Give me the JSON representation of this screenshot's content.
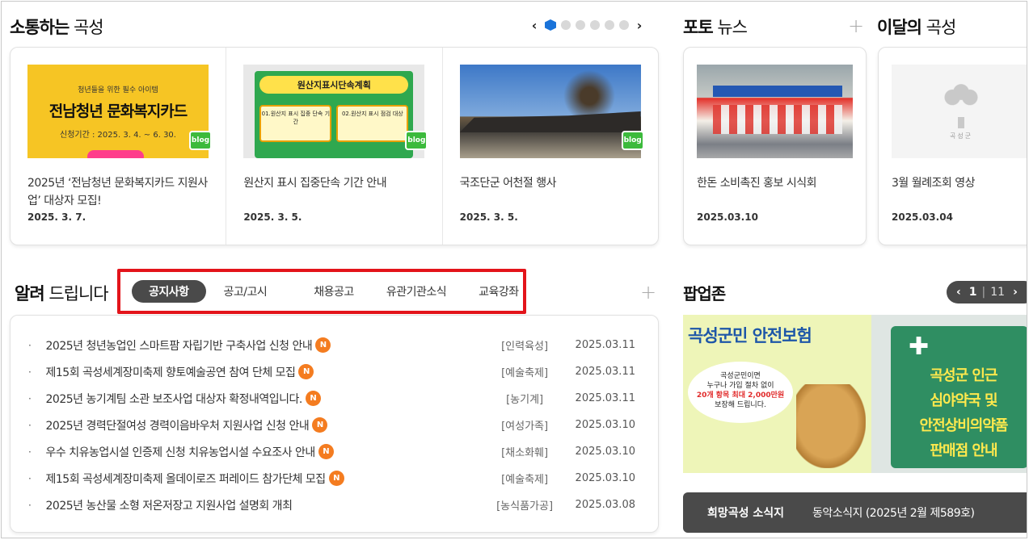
{
  "sections": {
    "blog": {
      "title_bold": "소통하는",
      "title_light": "곡성"
    },
    "photo": {
      "title_bold": "포토",
      "title_light": "뉴스"
    },
    "month": {
      "title_bold": "이달의",
      "title_light": "곡성"
    },
    "notice": {
      "title_bold": "알려",
      "title_light": "드립니다"
    },
    "popup": {
      "title_bold": "팝업존"
    }
  },
  "slider": {
    "prev": "‹",
    "next": "›",
    "dot_count": 6,
    "active_index": 0
  },
  "plus_symbol": "+",
  "blog_badge": "blog",
  "blog_cards": [
    {
      "title": "2025년 ‘전남청년 문화복지카드 지원사업’ 대상자 모집!",
      "date": "2025. 3. 7.",
      "thumb": {
        "sub": "청년들을 위한 필수 아이템",
        "main": "전남청년 문화복지카드",
        "period": "신청기간 : 2025. 3. 4. ~ 6. 30."
      }
    },
    {
      "title": "원산지 표시 집중단속 기간 안내",
      "date": "2025. 3. 5.",
      "thumb": {
        "head": "원산지표시단속계획",
        "box1": "01.원산지 표시 집중 단속 기간",
        "box2": "02.원산지 표시 점검 대상"
      }
    },
    {
      "title": "국조단군 어천절 행사",
      "date": "2025. 3. 5."
    }
  ],
  "photo_news": [
    {
      "title": "한돈 소비촉진 홍보 시식회",
      "date": "2025.03.10"
    }
  ],
  "month_items": [
    {
      "title": "3월 월례조회 영상",
      "date": "2025.03.04",
      "logo_text": "곡성군"
    }
  ],
  "notice_tabs": [
    {
      "label": "공지사항",
      "active": true
    },
    {
      "label": "공고/고시",
      "active": false
    },
    {
      "label": "채용공고",
      "active": false
    },
    {
      "label": "유관기관소식",
      "active": false
    },
    {
      "label": "교육강좌",
      "active": false
    }
  ],
  "new_badge": "N",
  "notices": [
    {
      "title": "2025년 청년농업인 스마트팜 자립기반 구축사업 신청 안내",
      "is_new": true,
      "category": "[인력육성]",
      "date": "2025.03.11"
    },
    {
      "title": "제15회 곡성세계장미축제 향토예술공연 참여 단체 모집",
      "is_new": true,
      "category": "[예술축제]",
      "date": "2025.03.11"
    },
    {
      "title": "2025년 농기계팀 소관 보조사업 대상자 확정내역입니다.",
      "is_new": true,
      "category": "[농기계]",
      "date": "2025.03.11"
    },
    {
      "title": "2025년 경력단절여성 경력이음바우처 지원사업 신청 안내",
      "is_new": true,
      "category": "[여성가족]",
      "date": "2025.03.10"
    },
    {
      "title": "우수 치유농업시설 인증제 신청 치유농업시설 수요조사 안내",
      "is_new": true,
      "category": "[채소화훼]",
      "date": "2025.03.10"
    },
    {
      "title": "제15회 곡성세계장미축제 올데이로즈 퍼레이드 참가단체 모집",
      "is_new": true,
      "category": "[예술축제]",
      "date": "2025.03.10"
    },
    {
      "title": "2025년 농산물 소형 저온저장고 지원사업 설명회 개최",
      "is_new": false,
      "category": "[농식품가공]",
      "date": "2025.03.08"
    }
  ],
  "popup": {
    "prev": "‹",
    "next": "›",
    "current": "1",
    "separator": "|",
    "total": "11",
    "banner_left_title": "곡성군민 안전보험",
    "bubble_line1": "곡성군민이면",
    "bubble_line2": "누구나 가입 절차 없이",
    "bubble_line3": "20개 항목 최대 2,000만원",
    "bubble_line4": "보장해 드립니다.",
    "banner_right_lines": [
      "곡성군 인근",
      "심야약국 및",
      "안전상비의약품",
      "판매점 안내"
    ]
  },
  "news_bar": {
    "label": "희망곡성 소식지",
    "link": "동악소식지 (2025년 2월 제589호)"
  },
  "colors": {
    "accent_blue": "#1a73d9",
    "tab_active_bg": "#4a4a4a",
    "highlight_red": "#e3141b",
    "new_badge": "#f47c20",
    "blog_green": "#3cba3c"
  }
}
